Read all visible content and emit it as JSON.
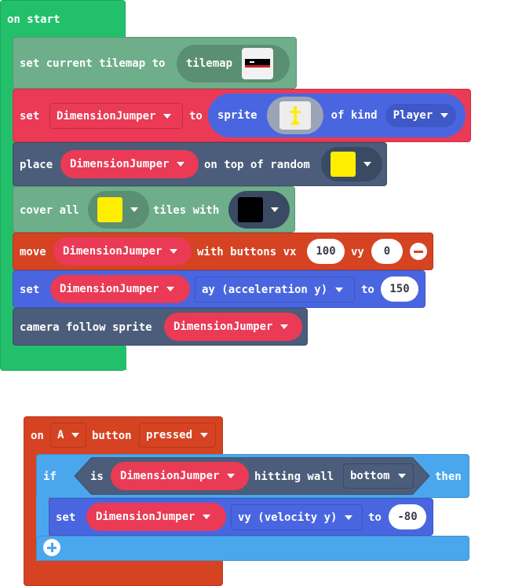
{
  "colors": {
    "event_green": "#23c06b",
    "tilemap_green": "#6fae8b",
    "sprite_red": "#ea3a55",
    "sprite_purple_blue": "#4966e0",
    "scene_slate": "#4b5d7a",
    "controller_orange": "#d54322",
    "logic_blue": "#4aa7ee",
    "yellow_tile": "#ffee00",
    "black_tile": "#000000"
  },
  "on_start": {
    "header": "on start",
    "set_tilemap": {
      "label": "set current tilemap to",
      "value": "tilemap",
      "thumbnail_icon": "tilemap-thumbnail-icon"
    },
    "set_sprite": {
      "set": "set",
      "variable": "DimensionJumper",
      "to": "to",
      "sprite": "sprite",
      "image_icon": "yellow-sprite-image-icon",
      "of_kind": "of kind",
      "kind": "Player"
    },
    "place": {
      "label": "place",
      "variable": "DimensionJumper",
      "on_top": "on top of random",
      "tile_color": "yellow"
    },
    "cover": {
      "label": "cover all",
      "tile_color": "yellow",
      "tiles_with": "tiles with",
      "cover_color": "black"
    },
    "move": {
      "label": "move",
      "variable": "DimensionJumper",
      "with_buttons_vx": "with buttons vx",
      "vx": "100",
      "vy_label": "vy",
      "vy": "0",
      "remove_icon": "minus-circle-icon"
    },
    "set_ay": {
      "set": "set",
      "variable": "DimensionJumper",
      "property": "ay (acceleration y)",
      "to": "to",
      "value": "150"
    },
    "camera": {
      "label": "camera follow sprite",
      "variable": "DimensionJumper"
    }
  },
  "on_a_pressed": {
    "on": "on",
    "button": "A",
    "button_label": "button",
    "event": "pressed",
    "if_block": {
      "if": "if",
      "is": "is",
      "variable": "DimensionJumper",
      "hitting_wall": "hitting wall",
      "direction": "bottom",
      "then": "then"
    },
    "set_vy": {
      "set": "set",
      "variable": "DimensionJumper",
      "property": "vy (velocity y)",
      "to": "to",
      "value": "-80"
    },
    "add_icon": "plus-circle-icon"
  }
}
